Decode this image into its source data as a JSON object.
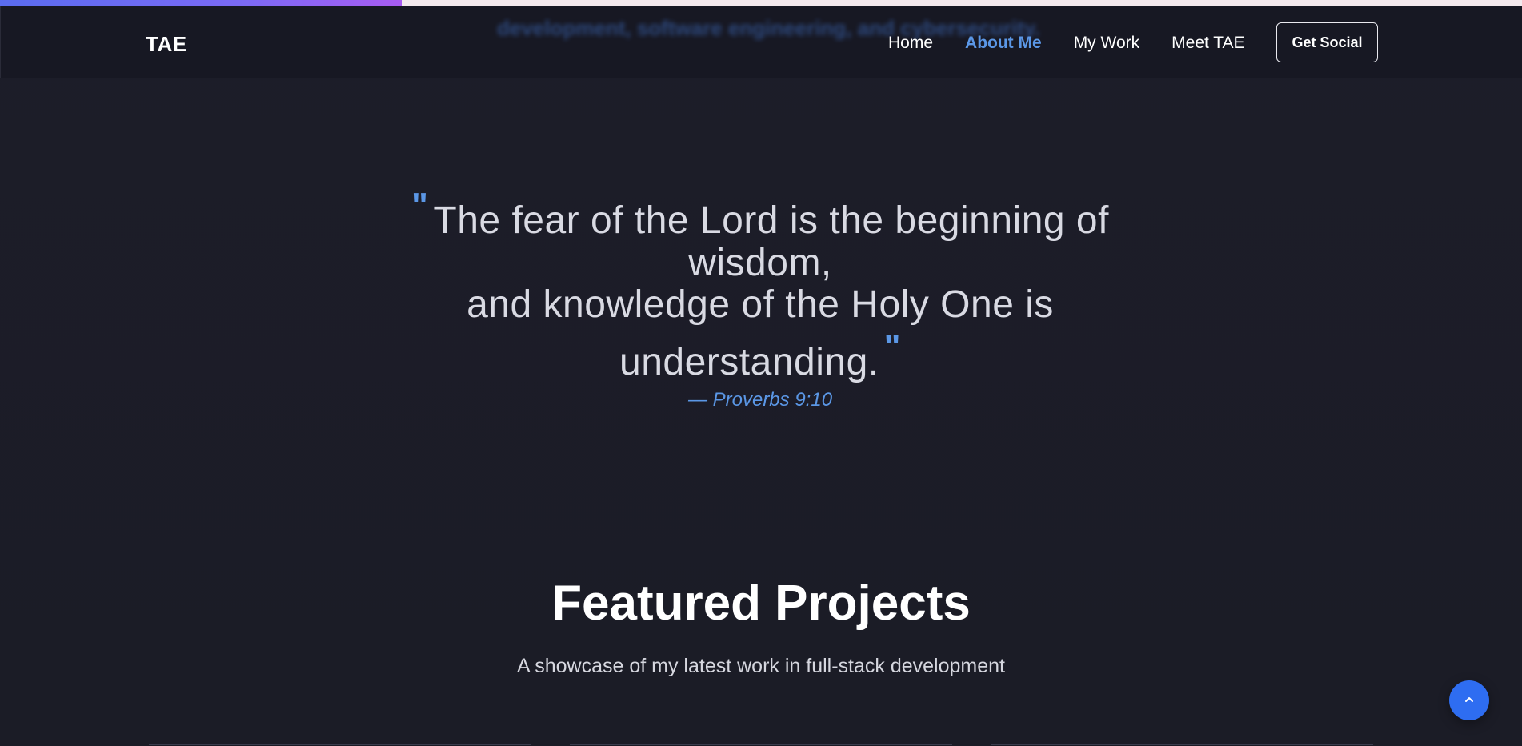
{
  "progress": {
    "fraction": 0.264
  },
  "navbar": {
    "brand": "TAE",
    "background_blur_text": "development, software engineering, and cybersecurity.",
    "links": [
      {
        "label": "Home",
        "active": false
      },
      {
        "label": "About Me",
        "active": true
      },
      {
        "label": "My Work",
        "active": false
      },
      {
        "label": "Meet TAE",
        "active": false
      }
    ],
    "cta_label": "Get Social"
  },
  "quote": {
    "line1": "The fear of the Lord is the beginning of wisdom,",
    "line2": "and knowledge of the Holy One is",
    "line3": "understanding.",
    "open_mark": "\"",
    "close_mark": "\"",
    "citation": "— Proverbs 9:10"
  },
  "featured": {
    "title": "Featured Projects",
    "subtitle": "A showcase of my latest work in full-stack development"
  },
  "colors": {
    "accent": "#5b97e6",
    "background": "#1b1c27",
    "nav_background": "#171823",
    "back_to_top": "#2e6df1"
  },
  "icons": {
    "back_to_top": "chevron-up-icon"
  }
}
